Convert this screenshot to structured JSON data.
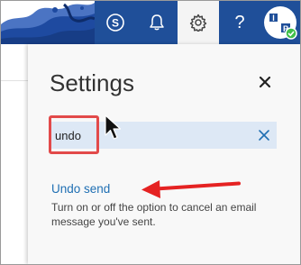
{
  "colors": {
    "topbar": "#1f4f99",
    "panel_background": "#f8f8f8",
    "search_background": "#dde8f5",
    "link": "#1f6fb3",
    "annotation_red": "#e24a4a",
    "presence_green": "#3fbf4a"
  },
  "topbar": {
    "icons": [
      "skype-icon",
      "bell-icon",
      "gear-icon",
      "help-icon"
    ],
    "help_label": "?",
    "avatar": {
      "letters": [
        "I",
        "P"
      ],
      "status": "available"
    }
  },
  "settings": {
    "title": "Settings",
    "search": {
      "value": "undo",
      "clear_icon": "close-icon"
    },
    "close_icon": "close-icon",
    "result": {
      "title": "Undo send",
      "description": "Turn on or off the option to cancel an email message you've sent."
    }
  },
  "annotations": {
    "highlight": "red-rectangle",
    "arrow": "red-arrow-pointing-left"
  }
}
